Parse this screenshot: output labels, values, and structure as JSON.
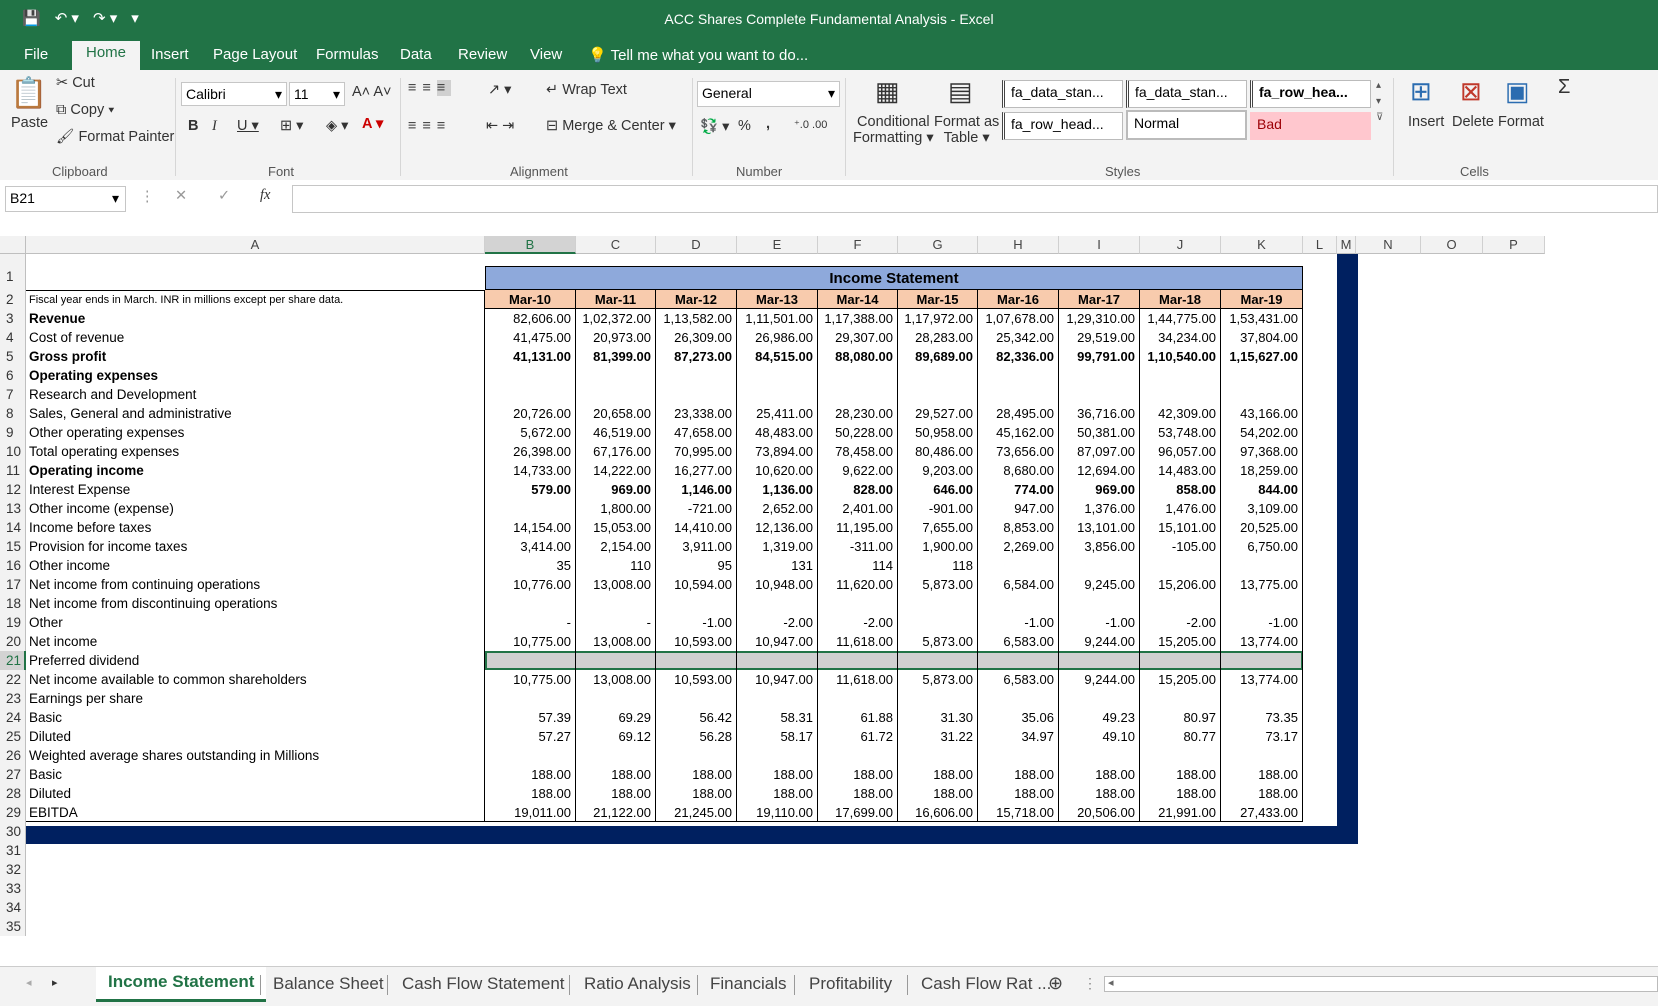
{
  "window": {
    "title": "ACC Shares Complete Fundamental Analysis - Excel"
  },
  "menu": [
    "File",
    "Home",
    "Insert",
    "Page Layout",
    "Formulas",
    "Data",
    "Review",
    "View"
  ],
  "tell_me": "Tell me what you want to do...",
  "clipboard": {
    "paste": "Paste",
    "cut": "Cut",
    "copy": "Copy",
    "format_painter": "Format Painter",
    "group": "Clipboard"
  },
  "font": {
    "name": "Calibri",
    "size": "11",
    "group": "Font"
  },
  "alignment": {
    "wrap": "Wrap Text",
    "merge": "Merge & Center",
    "group": "Alignment"
  },
  "number": {
    "format": "General",
    "percent": "%",
    "comma": ",",
    "group": "Number"
  },
  "styles": {
    "conditional": "Conditional",
    "conditional2": "Formatting",
    "format_as": "Format as",
    "format_as2": "Table",
    "cells": [
      "fa_data_stan...",
      "fa_data_stan...",
      "fa_row_hea...",
      "fa_row_head...",
      "Normal",
      "Bad"
    ],
    "group": "Styles"
  },
  "cells_group": {
    "insert": "Insert",
    "delete": "Delete",
    "format": "Format",
    "group": "Cells"
  },
  "formula_bar": {
    "name_box": "B21",
    "fx": "fx",
    "value": ""
  },
  "columns": [
    "A",
    "B",
    "C",
    "D",
    "E",
    "F",
    "G",
    "H",
    "I",
    "J",
    "K",
    "L",
    "M",
    "N",
    "O",
    "P"
  ],
  "sheet": {
    "title": "Income Statement",
    "note": "Fiscal year ends in March. INR in millions except per share data.",
    "periods": [
      "Mar-10",
      "Mar-11",
      "Mar-12",
      "Mar-13",
      "Mar-14",
      "Mar-15",
      "Mar-16",
      "Mar-17",
      "Mar-18",
      "Mar-19"
    ],
    "rows": [
      {
        "n": "3",
        "label": "Revenue",
        "bold": true,
        "vals": [
          "82,606.00",
          "1,02,372.00",
          "1,13,582.00",
          "1,11,501.00",
          "1,17,388.00",
          "1,17,972.00",
          "1,07,678.00",
          "1,29,310.00",
          "1,44,775.00",
          "1,53,431.00"
        ]
      },
      {
        "n": "4",
        "label": "Cost of revenue",
        "vals": [
          "41,475.00",
          "20,973.00",
          "26,309.00",
          "26,986.00",
          "29,307.00",
          "28,283.00",
          "25,342.00",
          "29,519.00",
          "34,234.00",
          "37,804.00"
        ]
      },
      {
        "n": "5",
        "label": "Gross profit",
        "bold": true,
        "vals": [
          "41,131.00",
          "81,399.00",
          "87,273.00",
          "84,515.00",
          "88,080.00",
          "89,689.00",
          "82,336.00",
          "99,791.00",
          "1,10,540.00",
          "1,15,627.00"
        ],
        "boldvals": true
      },
      {
        "n": "6",
        "label": "Operating expenses",
        "bold": true,
        "vals": [
          "",
          "",
          "",
          "",
          "",
          "",
          "",
          "",
          "",
          ""
        ]
      },
      {
        "n": "7",
        "label": "Research and Development",
        "vals": [
          "",
          "",
          "",
          "",
          "",
          "",
          "",
          "",
          "",
          ""
        ]
      },
      {
        "n": "8",
        "label": "Sales, General and administrative",
        "vals": [
          "20,726.00",
          "20,658.00",
          "23,338.00",
          "25,411.00",
          "28,230.00",
          "29,527.00",
          "28,495.00",
          "36,716.00",
          "42,309.00",
          "43,166.00"
        ]
      },
      {
        "n": "9",
        "label": "Other operating expenses",
        "vals": [
          "5,672.00",
          "46,519.00",
          "47,658.00",
          "48,483.00",
          "50,228.00",
          "50,958.00",
          "45,162.00",
          "50,381.00",
          "53,748.00",
          "54,202.00"
        ]
      },
      {
        "n": "10",
        "label": "Total operating expenses",
        "vals": [
          "26,398.00",
          "67,176.00",
          "70,995.00",
          "73,894.00",
          "78,458.00",
          "80,486.00",
          "73,656.00",
          "87,097.00",
          "96,057.00",
          "97,368.00"
        ]
      },
      {
        "n": "11",
        "label": "Operating income",
        "bold": true,
        "vals": [
          "14,733.00",
          "14,222.00",
          "16,277.00",
          "10,620.00",
          "9,622.00",
          "9,203.00",
          "8,680.00",
          "12,694.00",
          "14,483.00",
          "18,259.00"
        ]
      },
      {
        "n": "12",
        "label": "Interest Expense",
        "vals": [
          "579.00",
          "969.00",
          "1,146.00",
          "1,136.00",
          "828.00",
          "646.00",
          "774.00",
          "969.00",
          "858.00",
          "844.00"
        ],
        "boldvals": true
      },
      {
        "n": "13",
        "label": "Other income (expense)",
        "vals": [
          "",
          "1,800.00",
          "-721.00",
          "2,652.00",
          "2,401.00",
          "-901.00",
          "947.00",
          "1,376.00",
          "1,476.00",
          "3,109.00"
        ]
      },
      {
        "n": "14",
        "label": "Income before taxes",
        "vals": [
          "14,154.00",
          "15,053.00",
          "14,410.00",
          "12,136.00",
          "11,195.00",
          "7,655.00",
          "8,853.00",
          "13,101.00",
          "15,101.00",
          "20,525.00"
        ]
      },
      {
        "n": "15",
        "label": "Provision for income taxes",
        "vals": [
          "3,414.00",
          "2,154.00",
          "3,911.00",
          "1,319.00",
          "-311.00",
          "1,900.00",
          "2,269.00",
          "3,856.00",
          "-105.00",
          "6,750.00"
        ]
      },
      {
        "n": "16",
        "label": "Other income",
        "vals": [
          "35",
          "110",
          "95",
          "131",
          "114",
          "118",
          "",
          "",
          "",
          ""
        ]
      },
      {
        "n": "17",
        "label": "Net income from continuing operations",
        "vals": [
          "10,776.00",
          "13,008.00",
          "10,594.00",
          "10,948.00",
          "11,620.00",
          "5,873.00",
          "6,584.00",
          "9,245.00",
          "15,206.00",
          "13,775.00"
        ]
      },
      {
        "n": "18",
        "label": "Net income from discontinuing operations",
        "vals": [
          "",
          "",
          "",
          "",
          "",
          "",
          "",
          "",
          "",
          ""
        ]
      },
      {
        "n": "19",
        "label": "Other",
        "vals": [
          "-",
          "-",
          "-1.00",
          "-2.00",
          "-2.00",
          "",
          "-1.00",
          "-1.00",
          "-2.00",
          "-1.00"
        ]
      },
      {
        "n": "20",
        "label": "Net income",
        "vals": [
          "10,775.00",
          "13,008.00",
          "10,593.00",
          "10,947.00",
          "11,618.00",
          "5,873.00",
          "6,583.00",
          "9,244.00",
          "15,205.00",
          "13,774.00"
        ]
      },
      {
        "n": "21",
        "label": "Preferred dividend",
        "vals": [
          "",
          "",
          "",
          "",
          "",
          "",
          "",
          "",
          "",
          ""
        ],
        "selected": true
      },
      {
        "n": "22",
        "label": "Net income available to common shareholders",
        "vals": [
          "10,775.00",
          "13,008.00",
          "10,593.00",
          "10,947.00",
          "11,618.00",
          "5,873.00",
          "6,583.00",
          "9,244.00",
          "15,205.00",
          "13,774.00"
        ]
      },
      {
        "n": "23",
        "label": "Earnings per share",
        "vals": [
          "",
          "",
          "",
          "",
          "",
          "",
          "",
          "",
          "",
          ""
        ]
      },
      {
        "n": "24",
        "label": "Basic",
        "vals": [
          "57.39",
          "69.29",
          "56.42",
          "58.31",
          "61.88",
          "31.30",
          "35.06",
          "49.23",
          "80.97",
          "73.35"
        ]
      },
      {
        "n": "25",
        "label": "Diluted",
        "vals": [
          "57.27",
          "69.12",
          "56.28",
          "58.17",
          "61.72",
          "31.22",
          "34.97",
          "49.10",
          "80.77",
          "73.17"
        ]
      },
      {
        "n": "26",
        "label": "Weighted average shares outstanding in Millions",
        "vals": [
          "",
          "",
          "",
          "",
          "",
          "",
          "",
          "",
          "",
          ""
        ]
      },
      {
        "n": "27",
        "label": "Basic",
        "vals": [
          "188.00",
          "188.00",
          "188.00",
          "188.00",
          "188.00",
          "188.00",
          "188.00",
          "188.00",
          "188.00",
          "188.00"
        ]
      },
      {
        "n": "28",
        "label": "Diluted",
        "vals": [
          "188.00",
          "188.00",
          "188.00",
          "188.00",
          "188.00",
          "188.00",
          "188.00",
          "188.00",
          "188.00",
          "188.00"
        ]
      },
      {
        "n": "29",
        "label": "EBITDA",
        "vals": [
          "19,011.00",
          "21,122.00",
          "21,245.00",
          "19,110.00",
          "17,699.00",
          "16,606.00",
          "15,718.00",
          "20,506.00",
          "21,991.00",
          "27,433.00"
        ]
      }
    ],
    "extra_rows": [
      "30",
      "31",
      "32",
      "33",
      "34",
      "35"
    ]
  },
  "tabs": [
    "Income Statement",
    "Balance Sheet",
    "Cash Flow Statement",
    "Ratio Analysis",
    "Financials",
    "Profitability",
    "Cash Flow Rat ..."
  ],
  "colors": {
    "excel_green": "#217346",
    "title_band": "#8ea9db",
    "header_peach": "#f8cbad",
    "navy": "#002060",
    "bad_fill": "#ffc7ce"
  }
}
